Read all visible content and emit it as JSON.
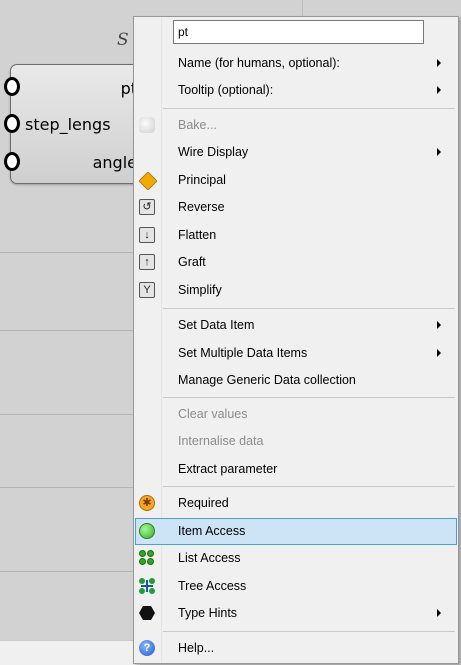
{
  "component": {
    "nickname": "S",
    "inputs": [
      "pt",
      "step_lengs",
      "angle"
    ]
  },
  "menu": {
    "name_value": "pt",
    "items": [
      {
        "label": "Name (for humans, optional):",
        "submenu": true
      },
      {
        "label": "Tooltip (optional):",
        "submenu": true
      },
      {
        "label": "Bake...",
        "disabled": true,
        "icon": "bake-icon"
      },
      {
        "label": "Wire Display",
        "submenu": true
      },
      {
        "label": "Principal",
        "icon": "principal-icon"
      },
      {
        "label": "Reverse",
        "icon": "reverse-icon"
      },
      {
        "label": "Flatten",
        "icon": "flatten-icon"
      },
      {
        "label": "Graft",
        "icon": "graft-icon"
      },
      {
        "label": "Simplify",
        "icon": "simplify-icon"
      },
      {
        "label": "Set Data Item",
        "submenu": true
      },
      {
        "label": "Set Multiple Data Items",
        "submenu": true
      },
      {
        "label": "Manage Generic Data collection"
      },
      {
        "label": "Clear values",
        "disabled": true
      },
      {
        "label": "Internalise data",
        "disabled": true
      },
      {
        "label": "Extract parameter"
      },
      {
        "label": "Required",
        "icon": "required-icon"
      },
      {
        "label": "Item Access",
        "icon": "item-access-icon",
        "highlighted": true
      },
      {
        "label": "List Access",
        "icon": "list-access-icon"
      },
      {
        "label": "Tree Access",
        "icon": "tree-access-icon"
      },
      {
        "label": "Type Hints",
        "submenu": true,
        "icon": "type-hints-icon"
      },
      {
        "label": "Help...",
        "icon": "help-icon"
      }
    ]
  }
}
